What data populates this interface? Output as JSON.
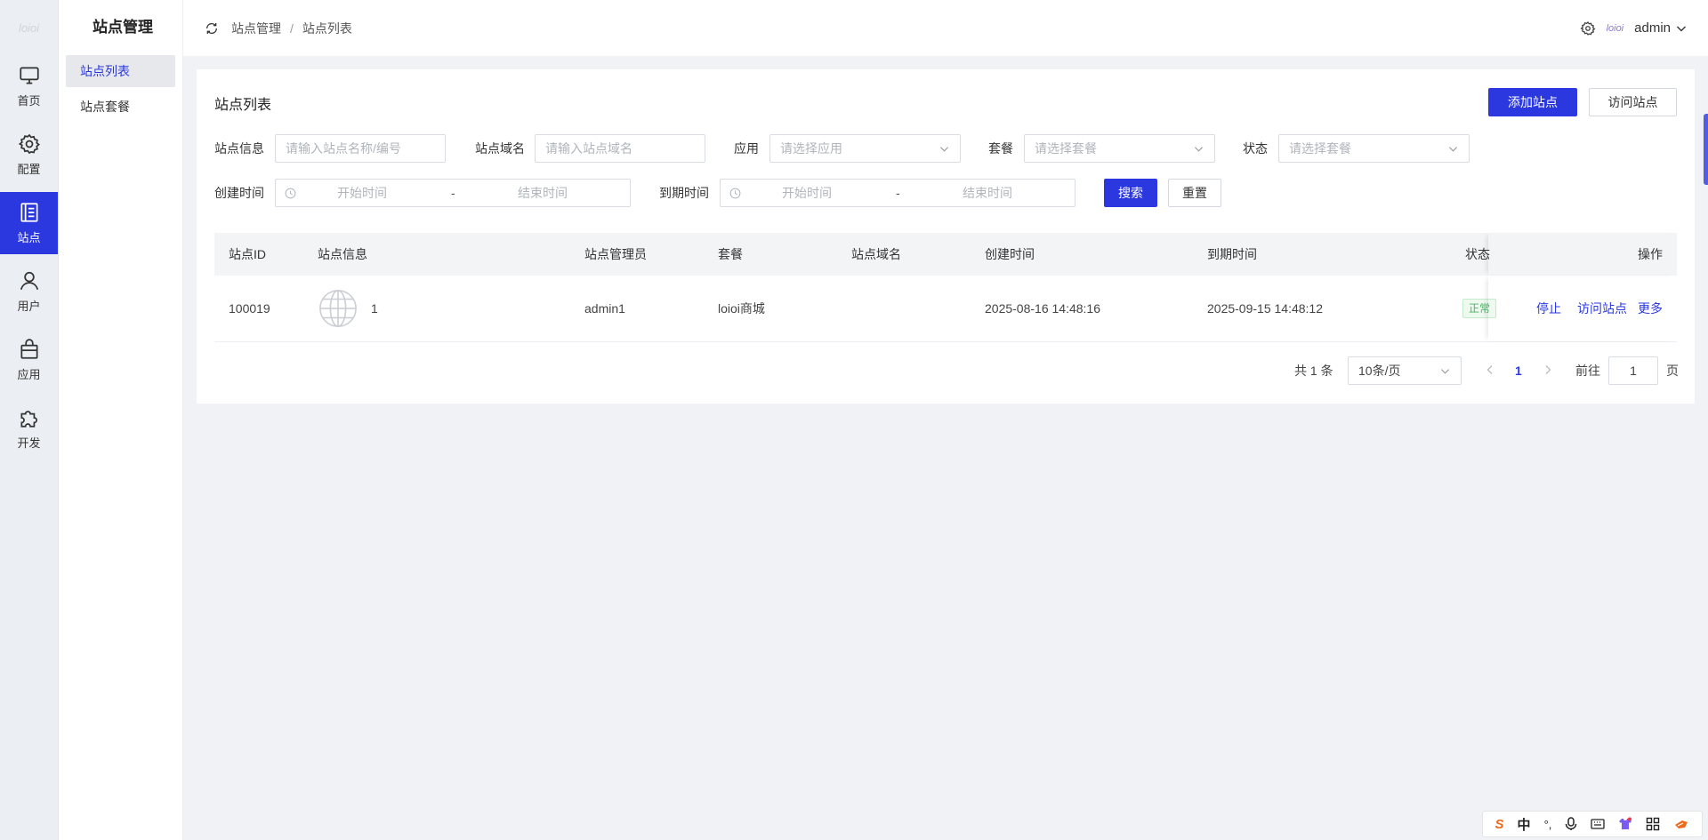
{
  "rail": {
    "logo": "loioi",
    "items": [
      {
        "label": "首页",
        "icon": "monitor-icon"
      },
      {
        "label": "配置",
        "icon": "gear-icon"
      },
      {
        "label": "站点",
        "icon": "site-list-icon"
      },
      {
        "label": "用户",
        "icon": "user-icon"
      },
      {
        "label": "应用",
        "icon": "bag-icon"
      },
      {
        "label": "开发",
        "icon": "puzzle-icon"
      }
    ]
  },
  "submenu": {
    "title": "站点管理",
    "items": [
      {
        "label": "站点列表"
      },
      {
        "label": "站点套餐"
      }
    ]
  },
  "header": {
    "breadcrumb": [
      "站点管理",
      "站点列表"
    ],
    "breadcrumb_sep": "/",
    "logo": "loioi",
    "user": "admin"
  },
  "card": {
    "title": "站点列表",
    "add_label": "添加站点",
    "visit_label": "访问站点"
  },
  "filters": {
    "site_info": {
      "label": "站点信息",
      "placeholder": "请输入站点名称/编号"
    },
    "domain": {
      "label": "站点域名",
      "placeholder": "请输入站点域名"
    },
    "app": {
      "label": "应用",
      "placeholder": "请选择应用"
    },
    "package": {
      "label": "套餐",
      "placeholder": "请选择套餐"
    },
    "status": {
      "label": "状态",
      "placeholder": "请选择套餐"
    },
    "create_time": {
      "label": "创建时间",
      "start": "开始时间",
      "end": "结束时间",
      "sep": "-"
    },
    "expire_time": {
      "label": "到期时间",
      "start": "开始时间",
      "end": "结束时间",
      "sep": "-"
    },
    "search_label": "搜索",
    "reset_label": "重置"
  },
  "table": {
    "columns": [
      "站点ID",
      "站点信息",
      "站点管理员",
      "套餐",
      "站点域名",
      "创建时间",
      "到期时间",
      "状态",
      "操作"
    ],
    "rows": [
      {
        "id": "100019",
        "name": "1",
        "admin": "admin1",
        "package": "loioi商城",
        "domain": "",
        "created": "2025-08-16 14:48:16",
        "expires": "2025-09-15 14:48:12",
        "status": "正常",
        "actions": [
          "停止",
          "访问站点",
          "更多"
        ]
      }
    ]
  },
  "pagination": {
    "total_text": "共 1 条",
    "page_size": "10条/页",
    "current_page": "1",
    "goto_label": "前往",
    "goto_value": "1",
    "page_suffix": "页"
  },
  "ime": {
    "items": [
      "S",
      "中",
      "°,",
      "mic-icon",
      "keyboard-icon",
      "shirt-icon",
      "grid-icon",
      "tool-icon"
    ]
  },
  "colors": {
    "primary": "#2b38e0",
    "status_green": "#4bb463",
    "background": "#f0f2f5"
  }
}
